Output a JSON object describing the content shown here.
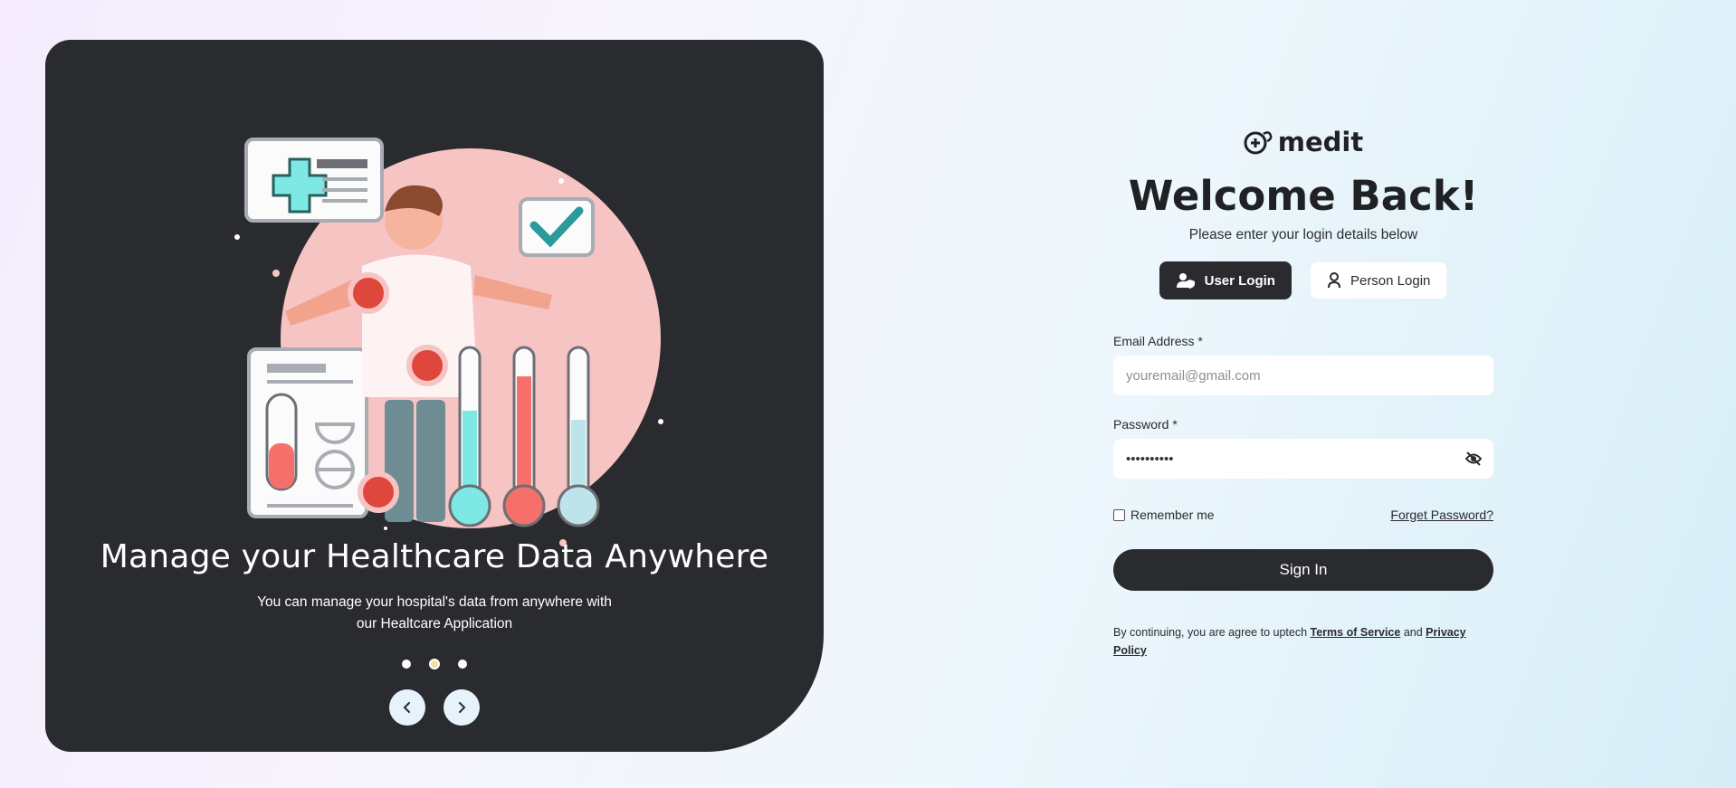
{
  "promo": {
    "title": "Manage your Healthcare Data Anywhere",
    "subtitle_line1": "You can manage your hospital's data from anywhere with",
    "subtitle_line2": "our Healtcare Application",
    "slides": {
      "count": 3,
      "active_index": 1
    }
  },
  "brand": {
    "name": "medit",
    "logo_icon": "stethoscope-plus-icon"
  },
  "form": {
    "heading": "Welcome Back!",
    "subheading": "Please enter your login details below",
    "tabs": [
      {
        "label": "User Login",
        "icon": "user-shield-icon",
        "active": true
      },
      {
        "label": "Person Login",
        "icon": "person-icon",
        "active": false
      }
    ],
    "email": {
      "label": "Email Address",
      "required_mark": "*",
      "placeholder": "youremail@gmail.com"
    },
    "password": {
      "label": "Password",
      "required_mark": "*",
      "value": "**********",
      "toggle_icon": "eye-off-icon"
    },
    "remember_label": "Remember me",
    "forgot_label": "Forget Password?",
    "submit_label": "Sign In",
    "terms": {
      "prefix": "By continuing, you are agree to uptech ",
      "tos_label": "Terms of Service",
      "and": " and ",
      "privacy_label": "Privacy Policy"
    }
  },
  "colors": {
    "dark": "#2a2b2f",
    "accent_red": "#e0473c",
    "accent_teal": "#7ee8e4",
    "pink": "#f9c8c8"
  }
}
